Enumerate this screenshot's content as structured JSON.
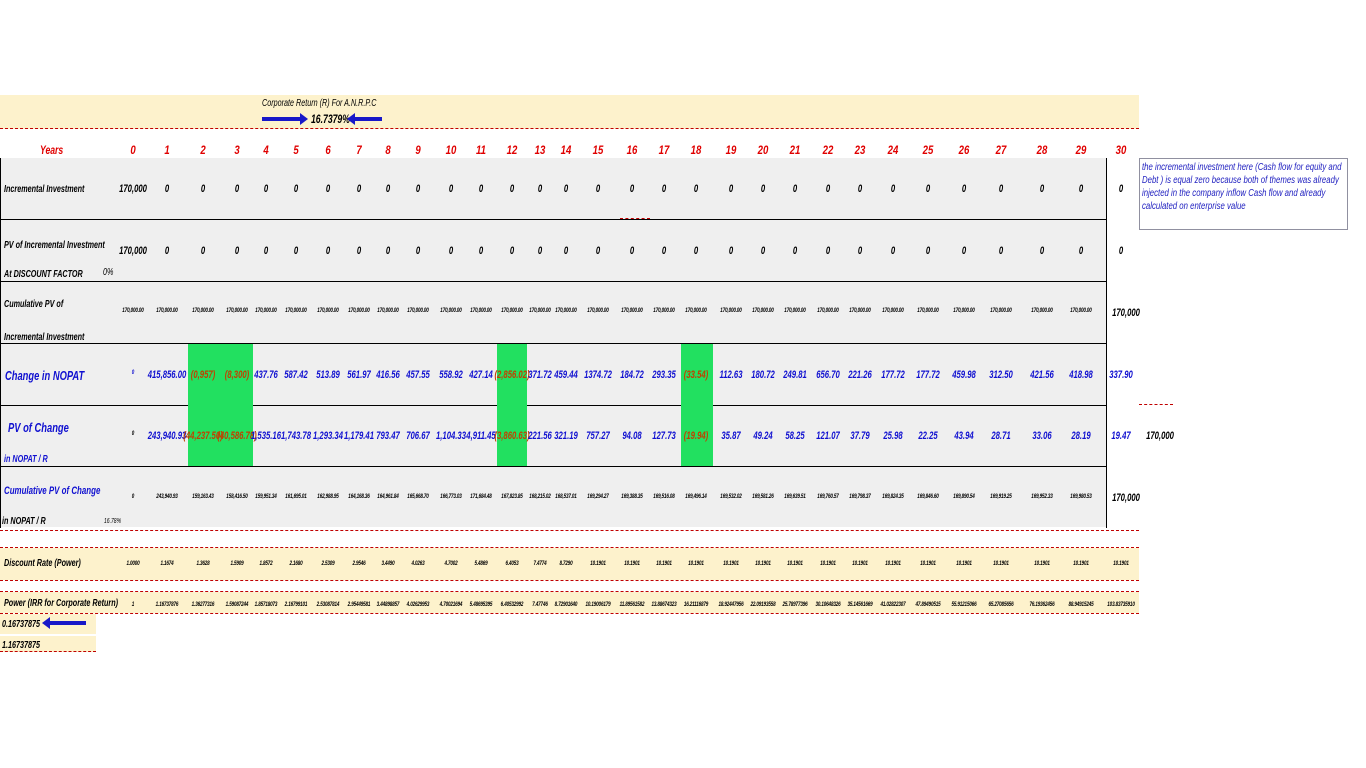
{
  "header": {
    "title": "Corporate Return (R) For A.N.R.P.C",
    "rate": "16.7379%"
  },
  "years_label": "Years",
  "years": [
    "0",
    "1",
    "2",
    "3",
    "4",
    "5",
    "6",
    "7",
    "8",
    "9",
    "10",
    "11",
    "12",
    "13",
    "14",
    "15",
    "16",
    "17",
    "18",
    "19",
    "20",
    "21",
    "22",
    "23",
    "24",
    "25",
    "26",
    "27",
    "28",
    "29",
    "30"
  ],
  "rows": {
    "incremental": {
      "label": "Incremental Investment",
      "values": [
        "170,000",
        "0",
        "0",
        "0",
        "0",
        "0",
        "0",
        "0",
        "0",
        "0",
        "0",
        "0",
        "0",
        "0",
        "0",
        "0",
        "0",
        "0",
        "0",
        "0",
        "0",
        "0",
        "0",
        "0",
        "0",
        "0",
        "0",
        "0",
        "0",
        "0",
        "0"
      ]
    },
    "pv_incremental": {
      "label": "PV of Incremental Investment",
      "label2": "At DISCOUNT FACTOR",
      "factor": "0%",
      "values": [
        "170,000",
        "0",
        "0",
        "0",
        "0",
        "0",
        "0",
        "0",
        "0",
        "0",
        "0",
        "0",
        "0",
        "0",
        "0",
        "0",
        "0",
        "0",
        "0",
        "0",
        "0",
        "0",
        "0",
        "0",
        "0",
        "0",
        "0",
        "0",
        "0",
        "0",
        "0"
      ]
    },
    "cum_pv_incremental": {
      "label": "Cumulative PV of",
      "label2": "Incremental Investment",
      "values": [
        "170,000.00",
        "170,000.00",
        "170,000.00",
        "170,000.00",
        "170,000.00",
        "170,000.00",
        "170,000.00",
        "170,000.00",
        "170,000.00",
        "170,000.00",
        "170,000.00",
        "170,000.00",
        "170,000.00",
        "170,000.00",
        "170,000.00",
        "170,000.00",
        "170,000.00",
        "170,000.00",
        "170,000.00",
        "170,000.00",
        "170,000.00",
        "170,000.00",
        "170,000.00",
        "170,000.00",
        "170,000.00",
        "170,000.00",
        "170,000.00",
        "170,000.00",
        "170,000.00",
        "170,000.00"
      ],
      "total": "170,000"
    },
    "change_nopat": {
      "label": "Change in NOPAT",
      "values": [
        "0",
        "415,856.00",
        "(0,957)",
        "(8,300)",
        "437.76",
        "587.42",
        "513.89",
        "561.97",
        "416.56",
        "457.55",
        "558.92",
        "427.14",
        "(2,856.02)",
        "371.72",
        "459.44",
        "1374.72",
        "184.72",
        "293.35",
        "(33.54)",
        "112.63",
        "180.72",
        "249.81",
        "656.70",
        "221.26",
        "177.72",
        "177.72",
        "459.98",
        "312.50",
        "421.56",
        "418.98",
        "337.90"
      ]
    },
    "pv_change": {
      "label": "PV of Change",
      "label2": "in NOPAT / R",
      "values": [
        "0",
        "243,940.93",
        "(44,237.50)",
        "(40,586.78)",
        "1,535.16",
        "1,743.78",
        "1,293.34",
        "1,179.41",
        "793.47",
        "706.67",
        "1,104.33",
        "4,911.45",
        "(3,860.63)",
        "221.56",
        "321.19",
        "757.27",
        "94.08",
        "127.73",
        "(19.94)",
        "35.87",
        "49.24",
        "58.25",
        "121.07",
        "37.79",
        "25.98",
        "22.25",
        "43.94",
        "28.71",
        "33.06",
        "28.19",
        "19.47"
      ],
      "total": "170,000"
    },
    "cum_pv_change": {
      "label": "Cumulative PV of Change",
      "label2": "in NOPAT / R",
      "pct": "16.78%",
      "values": [
        "0",
        "243,940.93",
        "159,163.43",
        "158,416.50",
        "159,951.34",
        "161,695.01",
        "162,988.95",
        "164,168.36",
        "164,961.84",
        "165,668.70",
        "166,773.03",
        "171,684.48",
        "167,823.85",
        "168,215.02",
        "168,537.01",
        "169,294.27",
        "169,388.35",
        "169,516.08",
        "169,496.14",
        "169,532.02",
        "169,581.26",
        "169,639.51",
        "169,760.57",
        "169,798.37",
        "169,824.35",
        "169,846.60",
        "169,890.54",
        "169,919.25",
        "169,952.33",
        "169,980.53"
      ],
      "total": "170,000"
    },
    "discount": {
      "label": "Discount Rate (Power)",
      "values": [
        "1.0000",
        "1.1674",
        "1.3628",
        "1.5909",
        "1.8572",
        "2.1680",
        "2.5309",
        "2.9546",
        "3.4490",
        "4.0263",
        "4.7002",
        "5.4869",
        "6.4053",
        "7.4774",
        "8.7290",
        "10.1901",
        "10.1901",
        "10.1901",
        "10.1901",
        "10.1901",
        "10.1901",
        "10.1901",
        "10.1901",
        "10.1901",
        "10.1901",
        "10.1901",
        "10.1901",
        "10.1901",
        "10.1901",
        "10.1901",
        "10.1901"
      ]
    },
    "power": {
      "label": "Power (IRR for Corporate Return)",
      "values": [
        "1",
        "1.16737876",
        "1.36277316",
        "1.59087244",
        "1.85718073",
        "2.16799101",
        "2.53087814",
        "2.95449581",
        "3.44898857",
        "4.02629953",
        "4.70021694",
        "5.48695395",
        "6.40532992",
        "7.47746",
        "8.72901640",
        "10.19006179",
        "11.89561582",
        "13.88674323",
        "16.21116879",
        "18.92447956",
        "22.09193558",
        "25.78977396",
        "30.10648326",
        "35.14561669",
        "41.02822307",
        "47.89490515",
        "55.91215066",
        "65.27085656",
        "76.19362456",
        "88.94915245",
        "103.83735910"
      ]
    }
  },
  "bottom": {
    "irr1": "0.16737875",
    "irr2": "1.16737875"
  },
  "note": "the incremental investment here (Cash flow for equity and Debt ) is equal zero because both of themes was already  injected in the company inflow Cash flow and already calculated on enterprise value",
  "colors": {
    "band": "#fdf2cc",
    "grey": "#efefef",
    "highlight": "#22e060",
    "accent": "#1010d0",
    "header": "#e00000"
  }
}
